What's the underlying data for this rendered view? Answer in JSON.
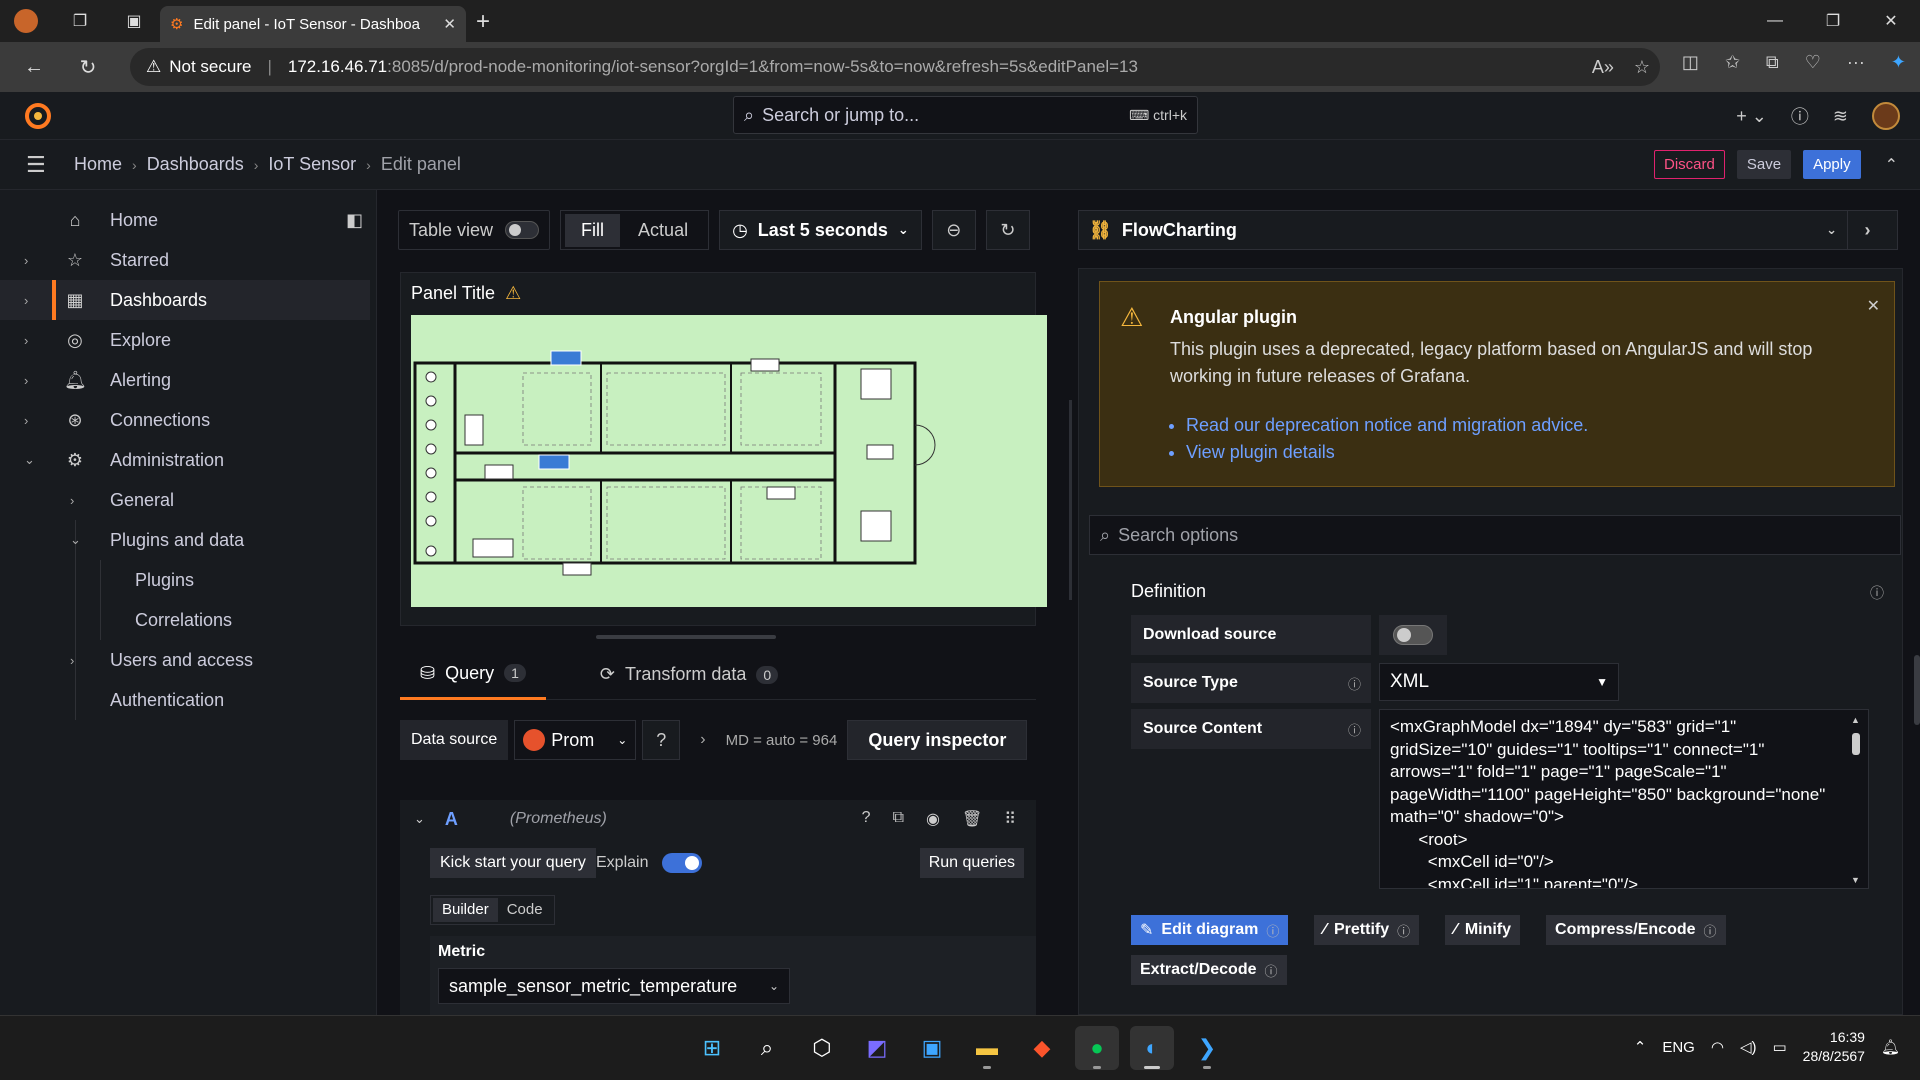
{
  "browser": {
    "tab_title": "Edit panel - IoT Sensor - Dashboa",
    "not_secure": "Not secure",
    "url_host": "172.16.46.71",
    "url_path": ":8085/d/prod-node-monitoring/iot-sensor?orgId=1&from=now-5s&to=now&refresh=5s&editPanel=13"
  },
  "grafana": {
    "search_placeholder": "Search or jump to...",
    "search_shortcut": "ctrl+k",
    "breadcrumb": [
      "Home",
      "Dashboards",
      "IoT Sensor",
      "Edit panel"
    ],
    "actions": {
      "discard": "Discard",
      "save": "Save",
      "apply": "Apply"
    }
  },
  "sidebar": {
    "items": [
      {
        "label": "Home",
        "icon": "home-icon"
      },
      {
        "label": "Starred",
        "icon": "star-icon"
      },
      {
        "label": "Dashboards",
        "icon": "grid-icon"
      },
      {
        "label": "Explore",
        "icon": "compass-icon"
      },
      {
        "label": "Alerting",
        "icon": "bell-icon"
      },
      {
        "label": "Connections",
        "icon": "link-icon"
      },
      {
        "label": "Administration",
        "icon": "gear-icon"
      },
      {
        "label": "General"
      },
      {
        "label": "Plugins and data"
      },
      {
        "label": "Plugins"
      },
      {
        "label": "Correlations"
      },
      {
        "label": "Users and access"
      },
      {
        "label": "Authentication"
      }
    ]
  },
  "panel_toolbar": {
    "table_view": "Table view",
    "fill": "Fill",
    "actual": "Actual",
    "time_range": "Last 5 seconds"
  },
  "panel": {
    "title": "Panel Title"
  },
  "query": {
    "tab_query": "Query",
    "tab_query_count": "1",
    "tab_transform": "Transform data",
    "tab_transform_count": "0",
    "datasource_label": "Data source",
    "datasource_value": "Prom",
    "md_text": "MD = auto = 964",
    "query_inspector": "Query inspector",
    "ref_id": "A",
    "ref_ds": "(Prometheus)",
    "kick_start": "Kick start your query",
    "explain": "Explain",
    "run_queries": "Run queries",
    "builder": "Builder",
    "code": "Code",
    "metric_label": "Metric",
    "metric_value": "sample_sensor_metric_temperature"
  },
  "options": {
    "viz_name": "FlowCharting",
    "angular_title": "Angular plugin",
    "angular_text": "This plugin uses a deprecated, legacy platform based on AngularJS and will stop working in future releases of Grafana.",
    "angular_link1": "Read our deprecation notice and migration advice.",
    "angular_link2": "View plugin details",
    "search_placeholder": "Search options",
    "definition": "Definition",
    "download_source": "Download source",
    "source_type": "Source Type",
    "source_type_value": "XML",
    "source_content": "Source Content",
    "source_content_value": "<mxGraphModel dx=\"1894\" dy=\"583\" grid=\"1\" gridSize=\"10\" guides=\"1\" tooltips=\"1\" connect=\"1\" arrows=\"1\" fold=\"1\" page=\"1\" pageScale=\"1\" pageWidth=\"1100\" pageHeight=\"850\" background=\"none\" math=\"0\" shadow=\"0\">\n      <root>\n        <mxCell id=\"0\"/>\n        <mxCell id=\"1\" parent=\"0\"/>",
    "btn_edit_diagram": "Edit diagram",
    "btn_prettify": "Prettify",
    "btn_minify": "Minify",
    "btn_compress": "Compress/Encode",
    "btn_extract": "Extract/Decode"
  },
  "taskbar": {
    "lang": "ENG",
    "time": "16:39",
    "date": "28/8/2567"
  },
  "colors": {
    "accent": "#3d71d9",
    "orange": "#ff7a21",
    "warning_bg": "#3b2f12",
    "floorplan_bg": "#c8f0c0"
  }
}
